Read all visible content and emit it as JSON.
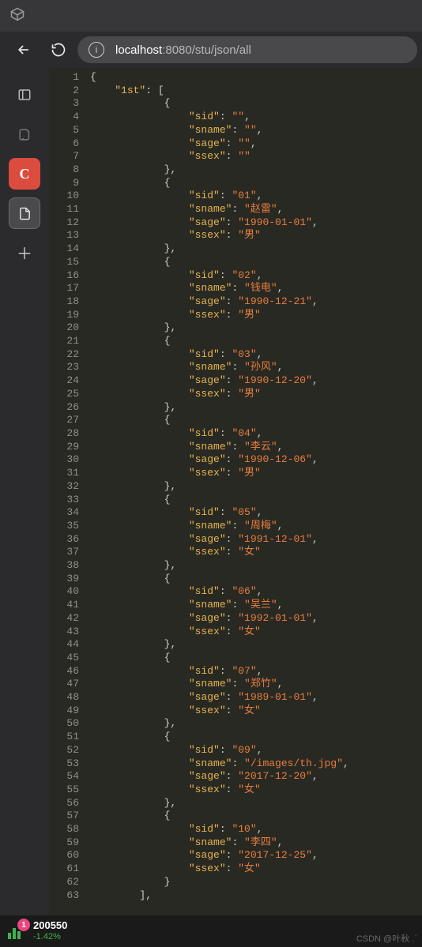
{
  "url": {
    "host": "localhost",
    "port": ":8080",
    "path": "/stu/json/all"
  },
  "sidebar": {
    "items": [
      "panel",
      "script",
      "C",
      "file",
      "plus"
    ]
  },
  "json_root_key": "1st",
  "records": [
    {
      "sid": "",
      "sname": "",
      "sage": "",
      "ssex": ""
    },
    {
      "sid": "01",
      "sname": "赵雷",
      "sage": "1990-01-01",
      "ssex": "男"
    },
    {
      "sid": "02",
      "sname": "钱电",
      "sage": "1990-12-21",
      "ssex": "男"
    },
    {
      "sid": "03",
      "sname": "孙风",
      "sage": "1990-12-20",
      "ssex": "男"
    },
    {
      "sid": "04",
      "sname": "李云",
      "sage": "1990-12-06",
      "ssex": "男"
    },
    {
      "sid": "05",
      "sname": "周梅",
      "sage": "1991-12-01",
      "ssex": "女"
    },
    {
      "sid": "06",
      "sname": "吴兰",
      "sage": "1992-01-01",
      "ssex": "女"
    },
    {
      "sid": "07",
      "sname": "郑竹",
      "sage": "1989-01-01",
      "ssex": "女"
    },
    {
      "sid": "09",
      "sname": "/images/th.jpg",
      "sage": "2017-12-20",
      "ssex": "女"
    },
    {
      "sid": "10",
      "sname": "李四",
      "sage": "2017-12-25",
      "ssex": "女"
    }
  ],
  "footer": {
    "badge": "1",
    "number": "200550",
    "delta": "-1.42%"
  },
  "watermark": "CSDN @叶秋 .`"
}
